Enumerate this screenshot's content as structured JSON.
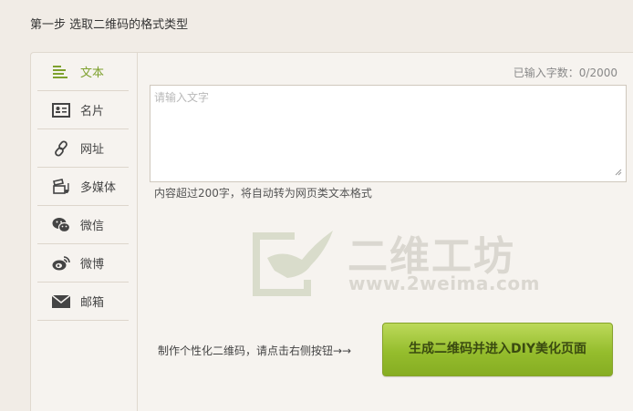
{
  "step_title": "第一步 选取二维码的格式类型",
  "sidebar": {
    "items": [
      {
        "label": "文本",
        "icon": "text-lines-icon",
        "active": true
      },
      {
        "label": "名片",
        "icon": "id-card-icon"
      },
      {
        "label": "网址",
        "icon": "link-chain-icon"
      },
      {
        "label": "多媒体",
        "icon": "media-icon"
      },
      {
        "label": "微信",
        "icon": "wechat-icon"
      },
      {
        "label": "微博",
        "icon": "weibo-icon"
      },
      {
        "label": "邮箱",
        "icon": "mail-icon"
      }
    ]
  },
  "editor": {
    "counter": "已输入字数：0/2000",
    "placeholder": "请输入文字",
    "value": "",
    "hint": "内容超过200字，将自动转为网页类文本格式"
  },
  "watermark": {
    "brand": "二维工坊",
    "url": "www.2weima.com"
  },
  "cta": {
    "tip": "制作个性化二维码，请点击右侧按钮→→",
    "button": "生成二维码并进入DIY美化页面"
  },
  "colors": {
    "accent": "#7ea12e",
    "background": "#f1ece6",
    "button_top": "#bcd95a",
    "button_bottom": "#86ad22"
  }
}
